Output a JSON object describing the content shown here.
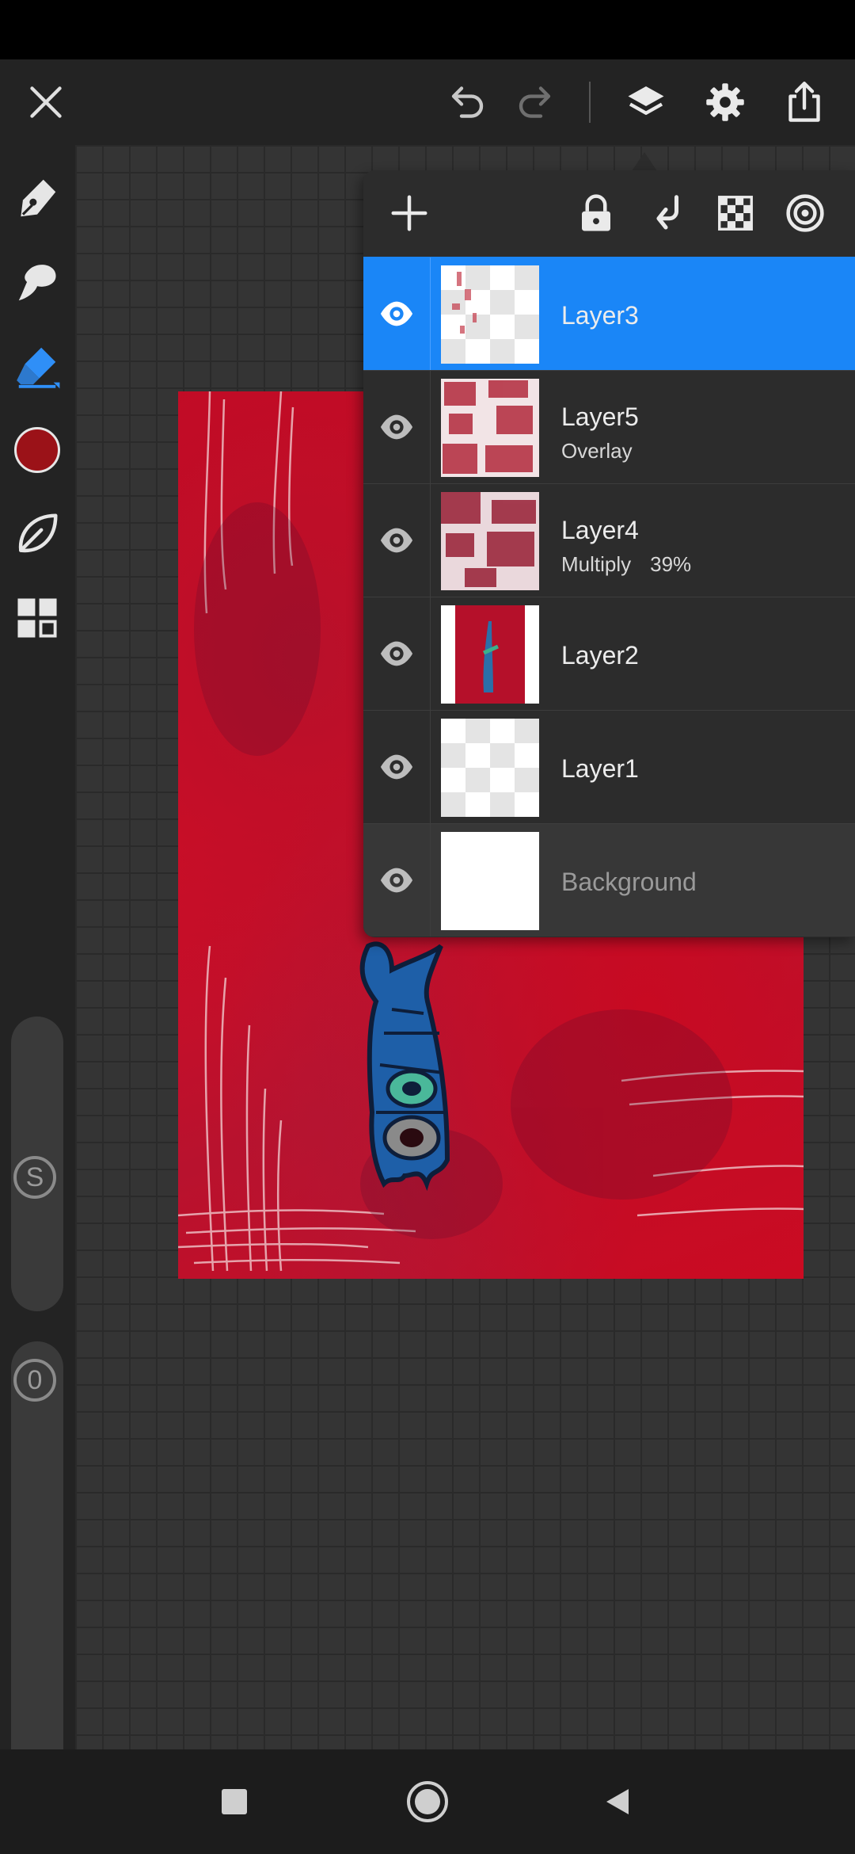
{
  "topbar": {
    "icons": [
      "close-icon",
      "undo-icon",
      "redo-icon",
      "layers-icon",
      "settings-icon",
      "share-icon"
    ]
  },
  "sidebar": {
    "tools": [
      "pen-tool-icon",
      "smudge-tool-icon",
      "eraser-tool-icon",
      "color-swatch",
      "brush-library-icon",
      "gallery-icon"
    ],
    "current_color": "#9b1218",
    "size_slider_label": "S",
    "opacity_slider_label": "0"
  },
  "layers_panel": {
    "toolbar_icons": [
      "add-layer-icon",
      "lock-icon",
      "clipping-mask-icon",
      "alpha-lock-icon",
      "layer-menu-icon"
    ],
    "layers": [
      {
        "name": "Layer3",
        "blend_mode": "",
        "opacity": "",
        "selected": true,
        "visible": true
      },
      {
        "name": "Layer5",
        "blend_mode": "Overlay",
        "opacity": "",
        "selected": false,
        "visible": true
      },
      {
        "name": "Layer4",
        "blend_mode": "Multiply",
        "opacity": "39%",
        "selected": false,
        "visible": true
      },
      {
        "name": "Layer2",
        "blend_mode": "",
        "opacity": "",
        "selected": false,
        "visible": true
      },
      {
        "name": "Layer1",
        "blend_mode": "",
        "opacity": "",
        "selected": false,
        "visible": true
      },
      {
        "name": "Background",
        "blend_mode": "",
        "opacity": "",
        "selected": false,
        "visible": true
      }
    ]
  },
  "colors": {
    "accent": "#1a86f7",
    "artwork_red": "#c80a22"
  },
  "navbar": {
    "icons": [
      "recent-apps-icon",
      "home-icon",
      "back-icon"
    ]
  }
}
